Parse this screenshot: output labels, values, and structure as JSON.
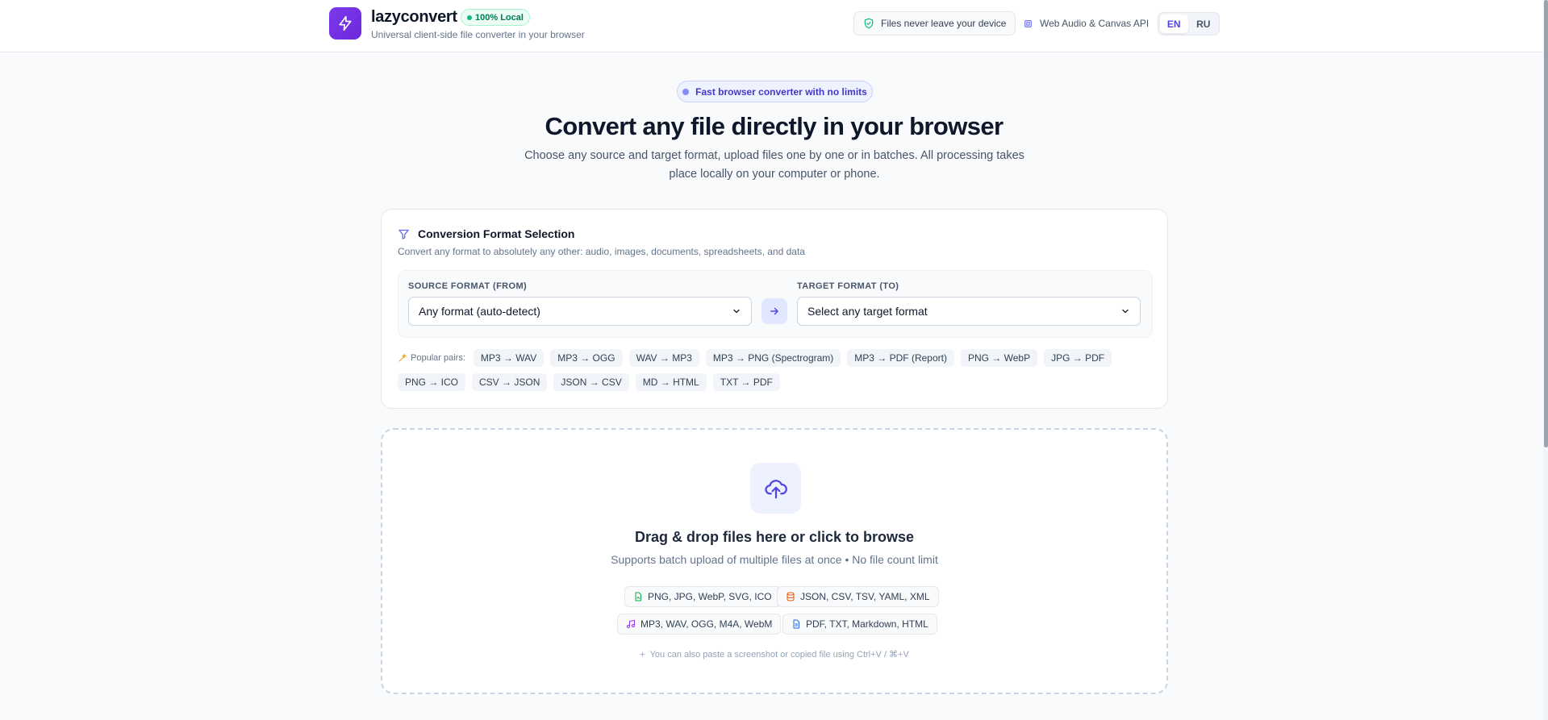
{
  "header": {
    "brand_name": "lazyconvert",
    "local_badge": "100% Local",
    "brand_sub": "Universal client-side file converter in your browser",
    "privacy_text": "Files never leave your device",
    "api_text": "Web Audio & Canvas API",
    "languages": [
      {
        "label": "EN",
        "active": true
      },
      {
        "label": "RU",
        "active": false
      }
    ]
  },
  "hero": {
    "pill": "Fast browser converter with no limits",
    "title": "Convert any file directly in your browser",
    "description": "Choose any source and target format, upload files one by one or in batches. All processing takes place locally on your computer or phone."
  },
  "format_card": {
    "title": "Conversion Format Selection",
    "subtitle": "Convert any format to absolutely any other: audio, images, documents, spreadsheets, and data",
    "source_label": "SOURCE FORMAT (FROM)",
    "source_value": "Any format (auto-detect)",
    "target_label": "TARGET FORMAT (TO)",
    "target_value": "Select any target format",
    "pairs_label": "Popular pairs:",
    "pairs": [
      "MP3 → WAV",
      "MP3 → OGG",
      "WAV → MP3",
      "MP3 → PNG (Spectrogram)",
      "MP3 → PDF (Report)",
      "PNG → WebP",
      "JPG → PDF",
      "PNG → ICO",
      "CSV → JSON",
      "JSON → CSV",
      "MD → HTML",
      "TXT → PDF"
    ]
  },
  "dropzone": {
    "title": "Drag & drop files here or click to browse",
    "subtitle": "Supports batch upload of multiple files at once • No file count limit",
    "types": [
      {
        "icon": "image-file-icon",
        "label": "PNG, JPG, WebP, SVG, ICO",
        "color": "#16a34a"
      },
      {
        "icon": "database-icon",
        "label": "JSON, CSV, TSV, YAML, XML",
        "color": "#ea580c"
      },
      {
        "icon": "music-note-icon",
        "label": "MP3, WAV, OGG, M4A, WebM",
        "color": "#9333ea"
      },
      {
        "icon": "document-icon",
        "label": "PDF, TXT, Markdown, HTML",
        "color": "#2563eb"
      }
    ],
    "paste_hint": "You can also paste a screenshot or copied file using Ctrl+V / ⌘+V"
  },
  "colors": {
    "accent": "#4f46e5",
    "brand": "#7c3aed",
    "success": "#10b981"
  }
}
